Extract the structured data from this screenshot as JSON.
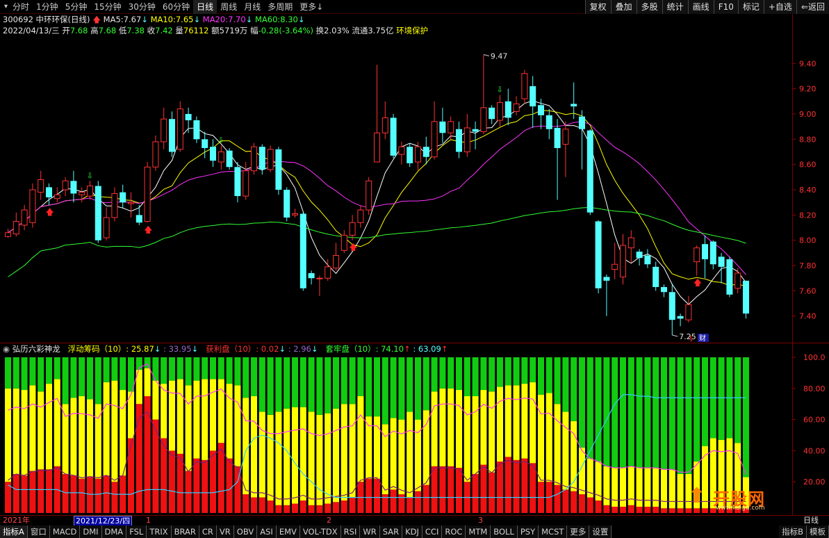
{
  "toolbar": {
    "menu_icon": "▾",
    "period_tabs": [
      "分时",
      "1分钟",
      "5分钟",
      "15分钟",
      "30分钟",
      "60分钟",
      "日线",
      "周线",
      "月线",
      "多周期",
      "更多"
    ],
    "active_period": "日线",
    "more_arrow": "↓",
    "right_tools": [
      "复权",
      "叠加",
      "多股",
      "统计",
      "画线",
      "F10",
      "标记",
      "+自选",
      "⇐返回"
    ]
  },
  "stock": {
    "code_name": "300692 中环环保(日线)",
    "ma5_label": "MA5:",
    "ma5": "7.67",
    "ma10_label": "MA10:",
    "ma10": "7.65",
    "ma20_label": "MA20:",
    "ma20": "7.70",
    "ma60_label": "MA60:",
    "ma60": "8.30",
    "date": "2022/04/13/三",
    "open_label": "开",
    "open": "7.68",
    "high_label": "高",
    "high": "7.68",
    "low_label": "低",
    "low": "7.38",
    "close_label": "收",
    "close": "7.42",
    "vol_label": "量",
    "vol": "76112",
    "amount_label": "额",
    "amount": "5719万",
    "change_label": "幅",
    "change": "-0.28(-3.64%)",
    "turnover_label": "换",
    "turnover": "2.03%",
    "float_label": "流通",
    "float_cap": "3.75亿",
    "sector": "环境保护",
    "high_mark": "9.47",
    "low_mark": "7.25",
    "fin_badge": "财"
  },
  "price_axis": {
    "ticks": [
      "9.40",
      "9.20",
      "9.00",
      "8.80",
      "8.60",
      "8.40",
      "8.20",
      "8.00",
      "7.80",
      "7.60",
      "7.40"
    ]
  },
  "indicator": {
    "name": "弘历六彩神龙",
    "float_label": "浮动筹码（10）: 25.87",
    "float_second": ": 33.95",
    "profit_label": "获利盘（10）: 0.02",
    "profit_second": ": 2.96",
    "trapped_label": "套牢盘（10）: 74.10",
    "trapped_second": ": 63.09",
    "axis_ticks": [
      "100.0",
      "80.00",
      "60.00",
      "40.00",
      "20.00"
    ]
  },
  "date_axis": {
    "year": "2021年",
    "cursor_date": "2021/12/23/四",
    "m1": "1",
    "m2": "2",
    "m3": "3",
    "period": "日线"
  },
  "indicator_tabs": [
    "指标A",
    "窗口",
    "MACD",
    "DMI",
    "DMA",
    "FSL",
    "TRIX",
    "BRAR",
    "CR",
    "VR",
    "OBV",
    "ASI",
    "EMV",
    "VOL-TDX",
    "RSI",
    "WR",
    "SAR",
    "KDJ",
    "CCI",
    "ROC",
    "MTM",
    "BOLL",
    "PSY",
    "MCST",
    "更多",
    "设置"
  ],
  "indicator_right_tabs": [
    "指标B",
    "模板"
  ],
  "watermark": {
    "brand": "开股网",
    "url": "www.kaigu.com"
  },
  "colors": {
    "up": "#ff3333",
    "down": "#54ffff",
    "ma5": "#ffffff",
    "ma10": "#ffff00",
    "ma20": "#ff33ff",
    "ma60": "#33ff33"
  },
  "chart_data": [
    {
      "type": "candlestick",
      "title": "300692 中环环保(日线)",
      "ylim": [
        7.25,
        9.55
      ],
      "ma_names": [
        "MA5",
        "MA10",
        "MA20",
        "MA60"
      ],
      "candles": [
        [
          8.03,
          8.06,
          8.02,
          8.09
        ],
        [
          8.05,
          8.15,
          8.03,
          8.22
        ],
        [
          8.12,
          8.24,
          8.08,
          8.28
        ],
        [
          8.14,
          8.4,
          8.1,
          8.45
        ],
        [
          8.38,
          8.48,
          8.32,
          8.55
        ],
        [
          8.42,
          8.34,
          8.28,
          8.45
        ],
        [
          8.33,
          8.36,
          8.3,
          8.42
        ],
        [
          8.4,
          8.47,
          8.35,
          8.5
        ],
        [
          8.47,
          8.37,
          8.3,
          8.55
        ],
        [
          8.36,
          8.38,
          8.3,
          8.42
        ],
        [
          8.35,
          8.43,
          8.32,
          8.47
        ],
        [
          8.43,
          8.0,
          7.98,
          8.47
        ],
        [
          8.02,
          8.18,
          8.0,
          8.26
        ],
        [
          8.18,
          8.37,
          8.15,
          8.42
        ],
        [
          8.38,
          8.3,
          8.25,
          8.44
        ],
        [
          8.29,
          8.3,
          8.18,
          8.38
        ],
        [
          8.2,
          8.14,
          8.12,
          8.28
        ],
        [
          8.15,
          8.58,
          8.14,
          8.62
        ],
        [
          8.58,
          8.78,
          8.55,
          8.83
        ],
        [
          8.78,
          8.96,
          8.72,
          9.05
        ],
        [
          8.96,
          8.7,
          8.66,
          9.02
        ],
        [
          8.72,
          9.04,
          8.7,
          9.1
        ],
        [
          9.0,
          8.95,
          8.85,
          9.05
        ],
        [
          8.95,
          8.8,
          8.77,
          8.98
        ],
        [
          8.8,
          8.73,
          8.65,
          8.86
        ],
        [
          8.74,
          8.63,
          8.58,
          8.8
        ],
        [
          8.62,
          8.7,
          8.56,
          8.75
        ],
        [
          8.71,
          8.58,
          8.56,
          8.73
        ],
        [
          8.58,
          8.35,
          8.3,
          8.62
        ],
        [
          8.35,
          8.55,
          8.32,
          8.62
        ],
        [
          8.55,
          8.74,
          8.52,
          8.77
        ],
        [
          8.74,
          8.56,
          8.52,
          8.76
        ],
        [
          8.56,
          8.72,
          8.54,
          8.75
        ],
        [
          8.72,
          8.4,
          8.36,
          8.74
        ],
        [
          8.4,
          8.18,
          8.15,
          8.42
        ],
        [
          8.2,
          8.21,
          8.18,
          8.25
        ],
        [
          8.21,
          7.62,
          7.6,
          8.22
        ],
        [
          7.74,
          7.7,
          7.65,
          7.76
        ],
        [
          7.7,
          7.7,
          7.56,
          7.72
        ],
        [
          7.7,
          7.79,
          7.68,
          7.85
        ],
        [
          7.78,
          7.88,
          7.76,
          7.98
        ],
        [
          7.92,
          8.04,
          7.9,
          8.08
        ],
        [
          8.04,
          8.14,
          8.0,
          8.2
        ],
        [
          8.14,
          8.24,
          8.1,
          8.28
        ],
        [
          8.24,
          8.47,
          8.2,
          8.5
        ],
        [
          8.62,
          8.85,
          8.62,
          9.39
        ],
        [
          8.85,
          8.97,
          8.8,
          9.1
        ],
        [
          8.97,
          8.67,
          8.65,
          9.0
        ],
        [
          8.68,
          8.74,
          8.6,
          8.78
        ],
        [
          8.74,
          8.61,
          8.58,
          8.77
        ],
        [
          8.62,
          8.74,
          8.55,
          8.78
        ],
        [
          8.74,
          8.66,
          8.6,
          8.82
        ],
        [
          8.66,
          8.94,
          8.64,
          9.1
        ],
        [
          8.94,
          8.85,
          8.77,
          9.05
        ],
        [
          8.85,
          8.94,
          8.8,
          8.98
        ],
        [
          8.88,
          8.7,
          8.65,
          8.94
        ],
        [
          8.7,
          8.89,
          8.66,
          9.0
        ],
        [
          8.88,
          8.86,
          8.72,
          8.94
        ],
        [
          8.86,
          9.05,
          8.84,
          9.47
        ],
        [
          9.05,
          8.96,
          8.92,
          9.07
        ],
        [
          8.95,
          9.09,
          8.9,
          9.15
        ],
        [
          9.1,
          8.97,
          8.91,
          9.2
        ],
        [
          9.02,
          9.08,
          8.99,
          9.14
        ],
        [
          9.12,
          9.32,
          9.08,
          9.35
        ],
        [
          9.22,
          9.06,
          8.89,
          9.3
        ],
        [
          9.07,
          8.99,
          8.88,
          9.12
        ],
        [
          8.99,
          8.88,
          8.8,
          9.04
        ],
        [
          8.89,
          8.73,
          8.32,
          8.96
        ],
        [
          8.76,
          8.88,
          8.5,
          8.94
        ],
        [
          9.08,
          9.06,
          8.96,
          9.25
        ],
        [
          8.98,
          8.88,
          8.56,
          9.03
        ],
        [
          8.87,
          8.22,
          8.2,
          8.88
        ],
        [
          8.15,
          7.62,
          7.58,
          8.16
        ],
        [
          7.71,
          7.68,
          7.4,
          7.73
        ],
        [
          7.77,
          7.81,
          7.69,
          7.98
        ],
        [
          7.71,
          7.96,
          7.65,
          8.05
        ],
        [
          7.94,
          8.02,
          7.82,
          8.08
        ],
        [
          7.91,
          7.86,
          7.8,
          7.93
        ],
        [
          7.88,
          7.81,
          7.78,
          7.93
        ],
        [
          7.79,
          7.63,
          7.6,
          7.83
        ],
        [
          7.63,
          7.59,
          7.55,
          7.65
        ],
        [
          7.59,
          7.37,
          7.25,
          7.66
        ],
        [
          7.4,
          7.38,
          7.32,
          7.42
        ],
        [
          7.37,
          7.49,
          7.35,
          7.56
        ],
        [
          7.83,
          7.94,
          7.72,
          7.96
        ],
        [
          7.97,
          7.85,
          7.7,
          8.04
        ],
        [
          7.99,
          7.81,
          7.77,
          8.0
        ],
        [
          7.87,
          7.79,
          7.66,
          7.9
        ],
        [
          7.85,
          7.57,
          7.55,
          7.87
        ],
        [
          7.62,
          7.74,
          7.58,
          7.78
        ],
        [
          7.68,
          7.42,
          7.38,
          7.68
        ]
      ]
    },
    {
      "type": "stacked-bar",
      "title": "弘历六彩神龙",
      "ylim": [
        0,
        100
      ],
      "series": [
        {
          "name": "获利盘",
          "values": [
            20,
            25,
            24,
            27,
            28,
            28,
            30,
            25,
            24,
            22,
            23,
            22,
            24,
            20,
            24,
            48,
            70,
            75,
            60,
            48,
            40,
            38,
            27,
            35,
            34,
            40,
            45,
            35,
            30,
            12,
            10,
            10,
            8,
            5,
            5,
            6,
            8,
            5,
            5,
            6,
            7,
            8,
            10,
            20,
            22,
            22,
            12,
            15,
            12,
            10,
            14,
            18,
            30,
            30,
            30,
            29,
            20,
            25,
            31,
            26,
            33,
            36,
            34,
            35,
            32,
            20,
            20,
            18,
            15,
            14,
            12,
            10,
            8,
            5,
            4,
            4,
            5,
            4,
            4,
            4,
            3,
            3,
            3,
            3,
            3,
            3,
            3,
            3,
            3,
            3,
            3
          ]
        },
        {
          "name": "浮动筹码",
          "values": [
            60,
            55,
            55,
            55,
            50,
            55,
            56,
            45,
            50,
            53,
            50,
            48,
            60,
            65,
            55,
            30,
            22,
            18,
            25,
            35,
            45,
            48,
            55,
            50,
            52,
            46,
            41,
            48,
            52,
            62,
            65,
            55,
            55,
            60,
            62,
            62,
            60,
            60,
            58,
            58,
            60,
            62,
            60,
            55,
            40,
            40,
            45,
            46,
            48,
            55,
            46,
            48,
            48,
            50,
            50,
            50,
            55,
            50,
            48,
            52,
            48,
            46,
            48,
            48,
            52,
            56,
            57,
            52,
            50,
            45,
            30,
            25,
            25,
            25,
            25,
            25,
            25,
            25,
            25,
            25,
            25,
            25,
            22,
            22,
            30,
            40,
            45,
            44,
            45,
            42,
            20
          ]
        },
        {
          "name": "套牢盘",
          "values": [
            20,
            20,
            21,
            18,
            22,
            17,
            14,
            30,
            26,
            25,
            27,
            30,
            16,
            15,
            21,
            22,
            8,
            7,
            15,
            17,
            15,
            14,
            18,
            15,
            14,
            14,
            14,
            17,
            18,
            26,
            25,
            35,
            37,
            35,
            33,
            32,
            32,
            35,
            37,
            36,
            33,
            30,
            30,
            25,
            38,
            38,
            43,
            39,
            40,
            35,
            40,
            34,
            22,
            20,
            20,
            21,
            25,
            25,
            21,
            22,
            19,
            18,
            18,
            17,
            16,
            24,
            23,
            30,
            35,
            41,
            58,
            65,
            67,
            70,
            71,
            71,
            70,
            71,
            71,
            71,
            72,
            72,
            75,
            75,
            67,
            57,
            52,
            53,
            52,
            55,
            77
          ]
        }
      ],
      "lines": [
        {
          "name": "获利盘均线",
          "values": [
            18,
            15,
            15,
            15,
            15,
            15,
            15,
            13,
            13,
            13,
            12,
            12,
            13,
            12,
            12,
            12,
            14,
            15,
            15,
            15,
            14,
            13,
            13,
            13,
            13,
            13,
            14,
            15,
            20,
            40,
            48,
            50,
            48,
            45,
            40,
            32,
            25,
            20,
            15,
            12,
            10,
            10,
            10,
            10,
            10,
            10,
            10,
            10,
            10,
            10,
            10,
            10,
            10,
            10,
            10,
            10,
            10,
            10,
            10,
            10,
            10,
            10,
            10,
            10,
            10,
            10,
            10,
            12,
            15,
            20,
            30,
            40,
            50,
            60,
            70,
            76,
            76,
            75,
            75,
            74,
            74,
            74,
            74,
            74,
            74,
            74,
            74,
            74,
            74,
            74,
            74
          ]
        }
      ]
    }
  ]
}
